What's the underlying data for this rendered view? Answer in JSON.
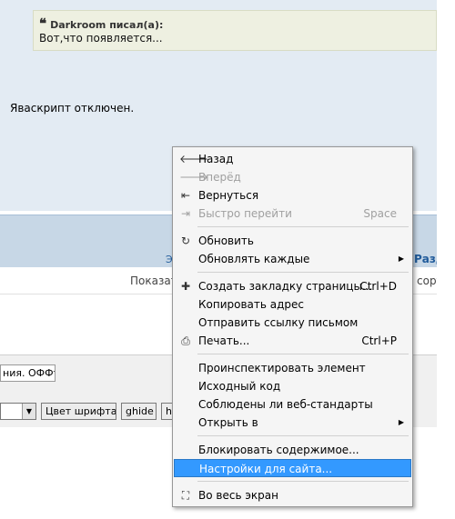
{
  "page": {
    "quote_author": "Darkroom писал(а):",
    "quote_text": "Вот,что появляется...",
    "post_text": "Яваскрипт отключен.",
    "band_link": "Разд",
    "band_left": "Э",
    "row2_left": "Показат",
    "row2_right": "сорт",
    "subject_value": "ния. ОФФто",
    "toolbar": {
      "color_btn": "Цвет шрифта",
      "ghide_btn": "ghide",
      "h_btn": "h"
    }
  },
  "menu": {
    "items": [
      {
        "label": "Назад",
        "icon": "arrow-left-icon",
        "glyph": "🡐",
        "shortcut": "",
        "disabled": false,
        "submenu": false
      },
      {
        "label": "Вперёд",
        "icon": "arrow-right-icon",
        "glyph": "🡒",
        "shortcut": "",
        "disabled": true,
        "submenu": false
      },
      {
        "label": "Вернуться",
        "icon": "rewind-icon",
        "glyph": "⇤",
        "shortcut": "",
        "disabled": false,
        "submenu": false
      },
      {
        "label": "Быстро перейти",
        "icon": "fast-forward-icon",
        "glyph": "⇥",
        "shortcut": "Space",
        "disabled": true,
        "submenu": false
      },
      {
        "label": "Обновить",
        "icon": "reload-icon",
        "glyph": "↻",
        "shortcut": "",
        "disabled": false,
        "submenu": false
      },
      {
        "label": "Обновлять каждые",
        "icon": "",
        "glyph": "",
        "shortcut": "",
        "disabled": false,
        "submenu": true
      },
      {
        "label": "Создать закладку страницы...",
        "icon": "plus-icon",
        "glyph": "✚",
        "shortcut": "Ctrl+D",
        "disabled": false,
        "submenu": false
      },
      {
        "label": "Копировать адрес",
        "icon": "",
        "glyph": "",
        "shortcut": "",
        "disabled": false,
        "submenu": false
      },
      {
        "label": "Отправить ссылку письмом",
        "icon": "",
        "glyph": "",
        "shortcut": "",
        "disabled": false,
        "submenu": false
      },
      {
        "label": "Печать...",
        "icon": "printer-icon",
        "glyph": "⎙",
        "shortcut": "Ctrl+P",
        "disabled": false,
        "submenu": false
      },
      {
        "label": "Проинспектировать элемент",
        "icon": "",
        "glyph": "",
        "shortcut": "",
        "disabled": false,
        "submenu": false
      },
      {
        "label": "Исходный код",
        "icon": "",
        "glyph": "",
        "shortcut": "",
        "disabled": false,
        "submenu": false
      },
      {
        "label": "Соблюдены ли веб-стандарты",
        "icon": "",
        "glyph": "",
        "shortcut": "",
        "disabled": false,
        "submenu": false
      },
      {
        "label": "Открыть в",
        "icon": "",
        "glyph": "",
        "shortcut": "",
        "disabled": false,
        "submenu": true
      },
      {
        "label": "Блокировать содержимое...",
        "icon": "",
        "glyph": "",
        "shortcut": "",
        "disabled": false,
        "submenu": false
      },
      {
        "label": "Настройки для сайта...",
        "icon": "",
        "glyph": "",
        "shortcut": "",
        "disabled": false,
        "submenu": false,
        "highlighted": true
      },
      {
        "label": "Во весь экран",
        "icon": "fullscreen-icon",
        "glyph": "⛶",
        "shortcut": "",
        "disabled": false,
        "submenu": false
      }
    ]
  },
  "colors": {
    "highlight": "#3399ff",
    "page_bg": "#e3ebf3",
    "quote_bg": "#eef0e1",
    "link": "#1f5a9a"
  }
}
